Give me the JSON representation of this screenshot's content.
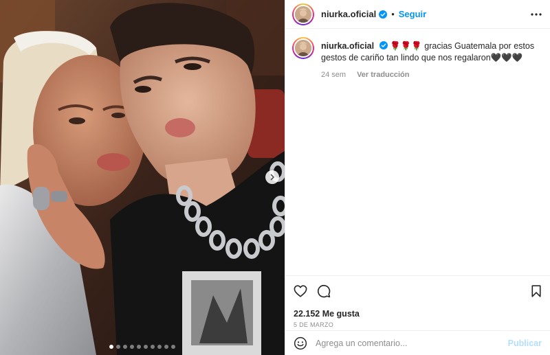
{
  "media": {
    "carousel_total": 10,
    "carousel_active_index": 0,
    "next_icon": "chevron-right-icon"
  },
  "header": {
    "username": "niurka.oficial",
    "verified": true,
    "separator": "•",
    "follow_label": "Seguir",
    "more_icon": "more-horizontal-icon"
  },
  "caption": {
    "username": "niurka.oficial",
    "emoji": "🌹🌹🌹",
    "text": "gracias Guatemala por estos gestos de cariño tan lindo que nos regalaron🖤🖤🖤",
    "time_ago": "24 sem",
    "translate_label": "Ver traducción"
  },
  "actions": {
    "like_icon": "heart-icon",
    "comment_icon": "comment-icon",
    "save_icon": "bookmark-icon",
    "likes_label": "22.152 Me gusta",
    "date_label": "5 DE MARZO"
  },
  "add_comment": {
    "emoji_icon": "smiley-icon",
    "placeholder": "Agrega un comentario...",
    "publish_label": "Publicar"
  },
  "colors": {
    "accent": "#0095f6",
    "publish_disabled": "#b2dffc",
    "verified": "#0095f6",
    "muted": "#8e8e8e"
  }
}
